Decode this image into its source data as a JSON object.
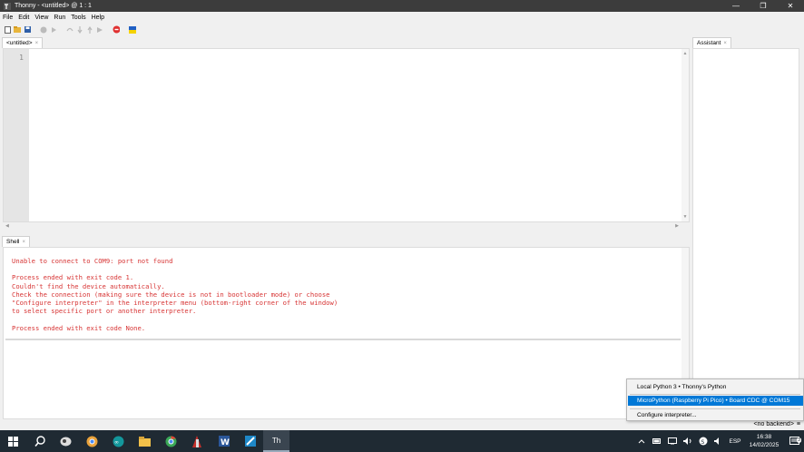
{
  "window": {
    "title": "Thonny  -  <untitled>  @  1 : 1",
    "minimize": "—",
    "maximize": "❐",
    "close": "✕"
  },
  "menu": [
    "File",
    "Edit",
    "View",
    "Run",
    "Tools",
    "Help"
  ],
  "toolbar": [
    "new-file-icon",
    "open-file-icon",
    "save-icon",
    "run-icon",
    "debug-icon",
    "step-over-icon",
    "step-into-icon",
    "step-out-icon",
    "resume-icon",
    "stop-icon",
    "flag-icon"
  ],
  "editor": {
    "tab_label": "<untitled>",
    "tab_close": "×",
    "line_number": "1"
  },
  "shell": {
    "tab_label": "Shell",
    "tab_close": "×",
    "output": "Unable to connect to COM9: port not found\n\nProcess ended with exit code 1.\nCouldn't find the device automatically.\nCheck the connection (making sure the device is not in bootloader mode) or choose\n\"Configure interpreter\" in the interpreter menu (bottom-right corner of the window)\nto select specific port or another interpreter.\n\nProcess ended with exit code None.",
    "output_color": "#d73434"
  },
  "assistant": {
    "tab_label": "Assistant",
    "tab_close": "×"
  },
  "statusbar": {
    "backend": "<no backend>",
    "menu_glyph": "≡"
  },
  "interpreter_menu": {
    "items": [
      "Local Python 3  •  Thonny's Python",
      "MicroPython (Raspberry Pi Pico)  •  Board CDC @ COM15",
      "Configure interpreter..."
    ],
    "selected_index": 1,
    "selected_color": "#0078d7"
  },
  "taskbar": {
    "apps": [
      "start-icon",
      "search-icon",
      "photos-icon",
      "chrome-icon",
      "arduino-icon",
      "file-explorer-icon",
      "chrome-alt-icon",
      "app-red-icon",
      "word-icon",
      "app-blue-icon",
      "thonny-icon"
    ],
    "thonny_label": "Th",
    "language": "ESP",
    "time": "16:38",
    "date": "14/02/2025",
    "notification_count": "3"
  }
}
